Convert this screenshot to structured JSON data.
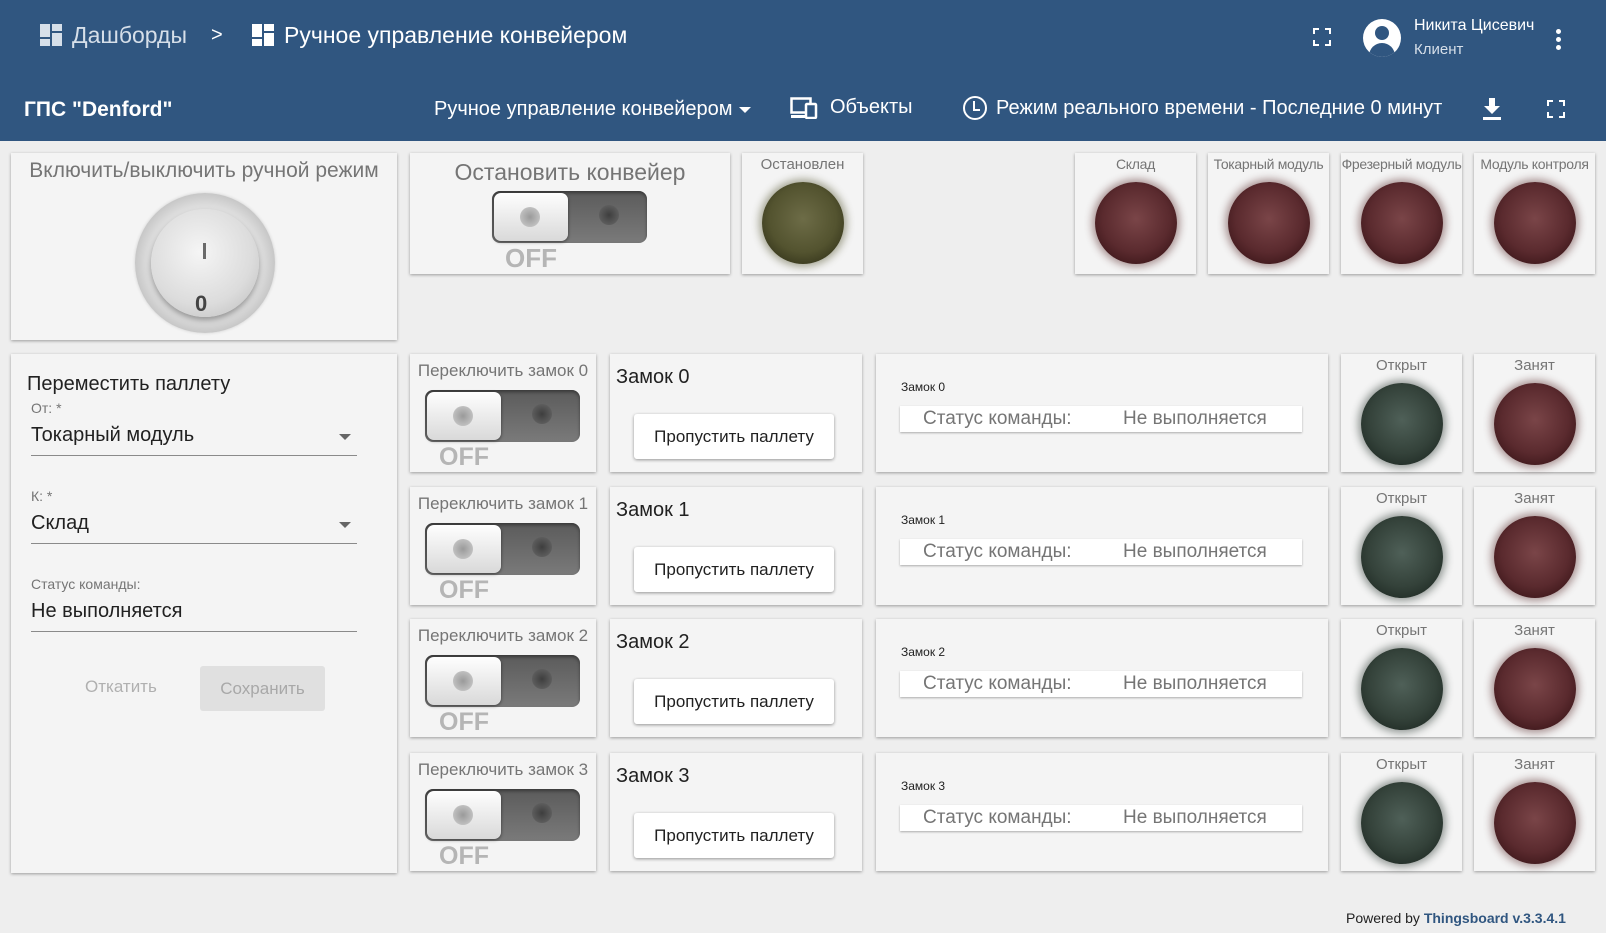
{
  "header": {
    "breadcrumb_root": "Дашборды",
    "breadcrumb_sep": ">",
    "breadcrumb_current": "Ручное управление конвейером",
    "user_name": "Никита Цисевич",
    "user_role": "Клиент"
  },
  "toolbar": {
    "title": "ГПС \"Denford\"",
    "state_label": "Ручное управление конвейером",
    "entities_label": "Объекты",
    "timewindow_label": "Режим реального времени - Последние 0 минут"
  },
  "manual_mode": {
    "title": "Включить/выключить ручной режим",
    "dial_mark_top": "I",
    "dial_mark_bottom": "0"
  },
  "stop_conveyor": {
    "title": "Остановить конвейер",
    "state": "OFF"
  },
  "stopped_lamp": {
    "title": "Остановлен",
    "color": "#53532f"
  },
  "module_lamps": [
    {
      "title": "Склад",
      "color": "#5a2a2e"
    },
    {
      "title": "Токарный модуль",
      "color": "#5a2a2e"
    },
    {
      "title": "Фрезерный модуль",
      "color": "#5a2a2e"
    },
    {
      "title": "Модуль контроля",
      "color": "#5a2a2e"
    }
  ],
  "move_pallet": {
    "title": "Переместить паллету",
    "from_label": "От: *",
    "from_value": "Токарный модуль",
    "to_label": "К: *",
    "to_value": "Склад",
    "status_label": "Статус команды:",
    "status_value": "Не выполняется",
    "undo_label": "Откатить",
    "save_label": "Сохранить"
  },
  "locks": [
    {
      "toggle_title": "Переключить замок 0",
      "toggle_state": "OFF",
      "name": "Замок 0",
      "skip_label": "Пропустить паллету",
      "status_title": "Замок 0",
      "status_key": "Статус команды:",
      "status_value": "Не выполняется",
      "open_title": "Открыт",
      "busy_title": "Занят"
    },
    {
      "toggle_title": "Переключить замок 1",
      "toggle_state": "OFF",
      "name": "Замок 1",
      "skip_label": "Пропустить паллету",
      "status_title": "Замок 1",
      "status_key": "Статус команды:",
      "status_value": "Не выполняется",
      "open_title": "Открыт",
      "busy_title": "Занят"
    },
    {
      "toggle_title": "Переключить замок 2",
      "toggle_state": "OFF",
      "name": "Замок 2",
      "skip_label": "Пропустить паллету",
      "status_title": "Замок 2",
      "status_key": "Статус команды:",
      "status_value": "Не выполняется",
      "open_title": "Открыт",
      "busy_title": "Занят"
    },
    {
      "toggle_title": "Переключить замок 3",
      "toggle_state": "OFF",
      "name": "Замок 3",
      "skip_label": "Пропустить паллету",
      "status_title": "Замок 3",
      "status_key": "Статус команды:",
      "status_value": "Не выполняется",
      "open_title": "Открыт",
      "busy_title": "Занят"
    }
  ],
  "footer": {
    "prefix": "Powered by",
    "link": "Thingsboard v.3.3.4.1"
  },
  "colors": {
    "header_bg": "#305680",
    "page_bg": "#eeeeee",
    "lamp_red": "#5a2a2e",
    "lamp_green": "#34423a",
    "lamp_olive": "#53532f"
  }
}
